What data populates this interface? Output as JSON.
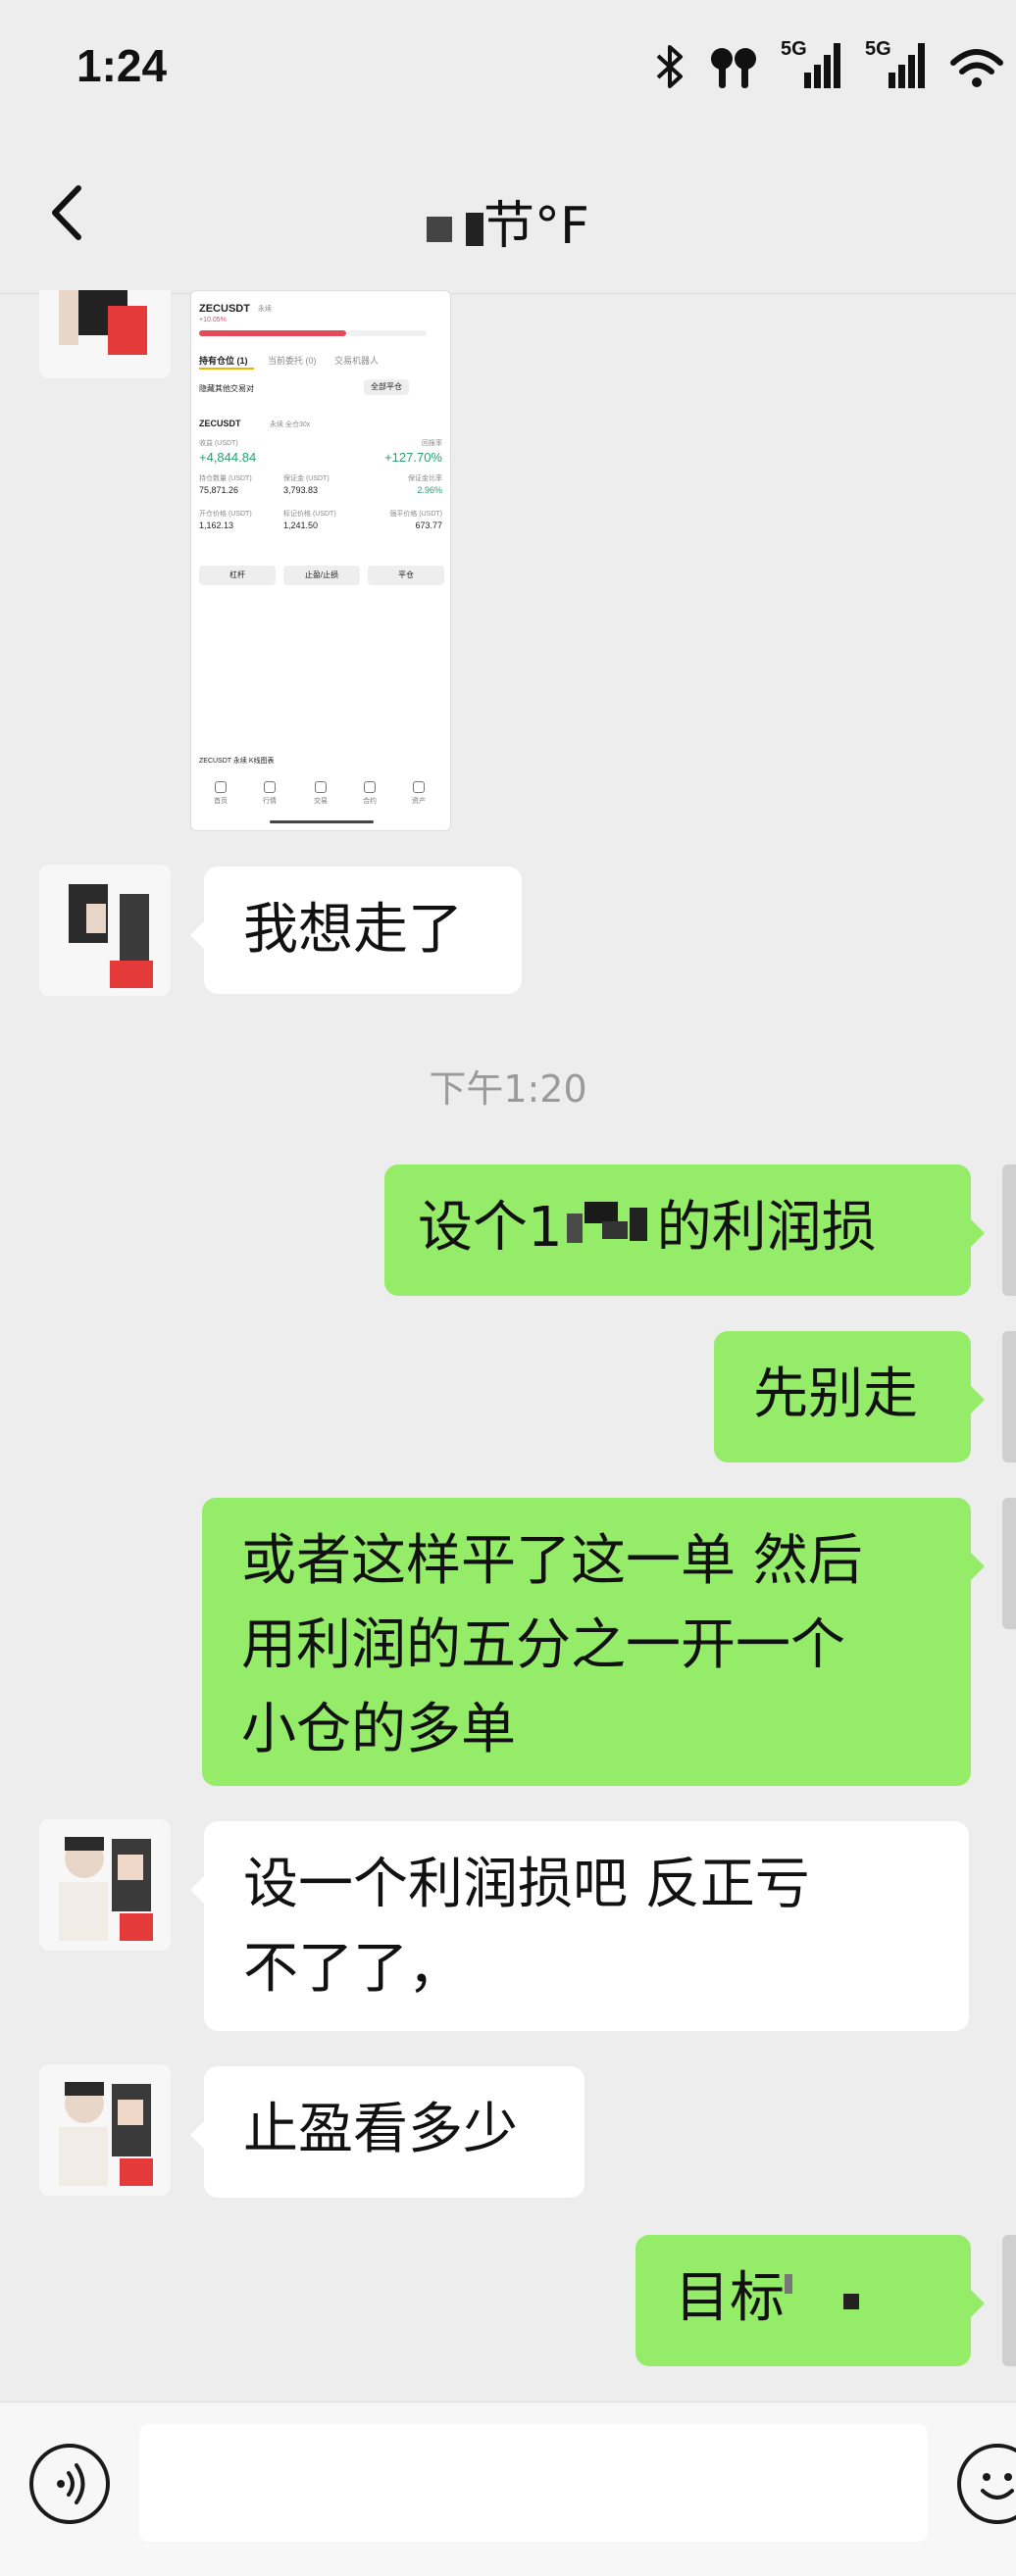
{
  "status_bar": {
    "time": "1:24",
    "network_label_1": "5G",
    "network_label_2": "5G",
    "icons": [
      "bluetooth-icon",
      "earbuds-icon",
      "signal-5g-icon",
      "signal-5g-icon",
      "wifi-icon"
    ]
  },
  "header": {
    "title_visible": "节°F",
    "back_icon": "chevron-left-icon"
  },
  "messages": [
    {
      "side": "left",
      "type": "image",
      "shot": {
        "symbol": "ZECUSDT",
        "perp": "永续",
        "top_change": "+10.05%",
        "tabs": [
          "持有仓位 (1)",
          "当前委托 (0)",
          "交易机器人"
        ],
        "hide_other": "隐藏其他交易对",
        "close_all": "全部平仓",
        "pos_symbol": "ZECUSDT",
        "pos_tags": "永续  全仓30x",
        "pnl_label": "收益 (USDT)",
        "pnl_value": "+4,844.84",
        "roi_label": "回报率",
        "roi_value": "+127.70%",
        "size_label": "持仓数量 (USDT)",
        "size_value": "75,871.26",
        "margin_label": "保证金 (USDT)",
        "margin_value": "3,793.83",
        "margin_ratio_label": "保证金比率",
        "margin_ratio_value": "2.96%",
        "entry_label": "开仓价格 (USDT)",
        "entry_value": "1,162.13",
        "mark_label": "标记价格 (USDT)",
        "mark_value": "1,241.50",
        "liq_label": "强平价格 (USDT)",
        "liq_value": "673.77",
        "buttons": [
          "杠杆",
          "止盈/止损",
          "平仓"
        ],
        "kline": "ZECUSDT 永续 K线图表",
        "nav": [
          "首页",
          "行情",
          "交易",
          "合约",
          "资产"
        ]
      }
    },
    {
      "side": "left",
      "type": "text",
      "lines": [
        "我想走了"
      ]
    },
    {
      "side": "center",
      "type": "timestamp",
      "text": "下午1:20"
    },
    {
      "side": "right",
      "type": "text",
      "lines": [
        "设个1",
        "的利润损"
      ]
    },
    {
      "side": "right",
      "type": "text",
      "lines": [
        "先别走"
      ]
    },
    {
      "side": "right",
      "type": "text",
      "lines": [
        "或者这样平了这一单 然后",
        "用利润的五分之一开一个",
        "小仓的多单"
      ]
    },
    {
      "side": "left",
      "type": "text",
      "lines": [
        "设一个利润损吧 反正亏",
        "不了了，"
      ]
    },
    {
      "side": "left",
      "type": "text",
      "lines": [
        "止盈看多少"
      ]
    },
    {
      "side": "right",
      "type": "text",
      "lines": [
        "目标"
      ]
    }
  ],
  "input_bar": {
    "placeholder": "",
    "voice_icon": "voice-icon",
    "emoji_icon": "emoji-icon"
  },
  "colors": {
    "background": "#ededed",
    "bubble_self": "#95ec69",
    "bubble_other": "#ffffff",
    "timestamp": "#9a9a9a"
  }
}
